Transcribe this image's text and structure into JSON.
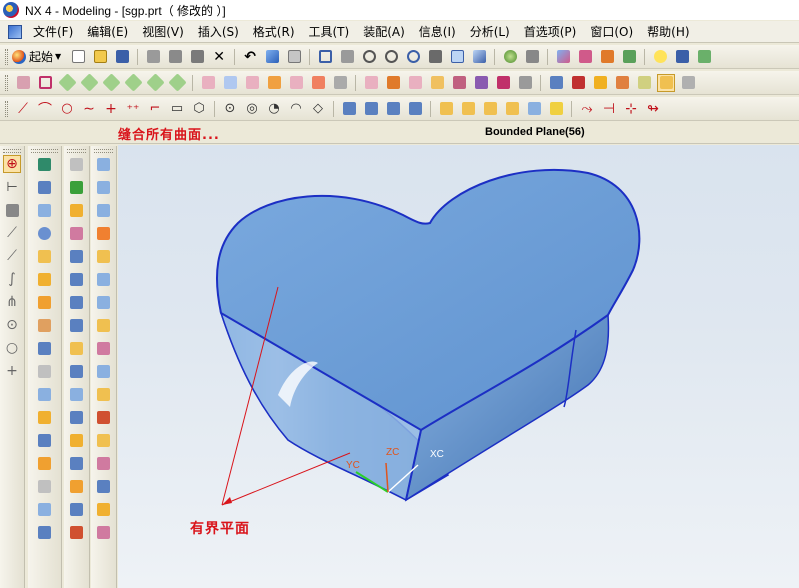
{
  "window": {
    "title": "NX 4 - Modeling - [sgp.prt（ 修改的 ）]"
  },
  "menu": {
    "items": [
      "文件(F)",
      "编辑(E)",
      "视图(V)",
      "插入(S)",
      "格式(R)",
      "工具(T)",
      "装配(A)",
      "信息(I)",
      "分析(L)",
      "首选项(P)",
      "窗口(O)",
      "帮助(H)"
    ]
  },
  "toolbar": {
    "start_label": "起始"
  },
  "cue": {
    "prompt": "缝合所有曲面..."
  },
  "status": {
    "selection": "Bounded Plane(56)"
  },
  "viewport": {
    "callout_label": "有界平面",
    "axes": {
      "xc": "XC",
      "yc": "YC",
      "zc": "ZC"
    }
  },
  "colors": {
    "annotation_red": "#d9141b",
    "model_face_blue": "#6fa0d8",
    "model_edge_blue": "#1c2fc4",
    "axis_xc": "#ffffff",
    "axis_yc": "#e0541c",
    "axis_zc": "#e0541c"
  },
  "icons": {
    "toolbar_row1": [
      "start-ball-icon",
      "new-file-icon",
      "open-folder-icon",
      "save-icon",
      "cut-icon",
      "copy-icon",
      "paste-icon",
      "delete-icon",
      "undo-icon",
      "repeat-icon",
      "select-icon",
      "fit-icon",
      "zoom-window-icon",
      "zoom-icon",
      "pan-icon",
      "rotate-icon",
      "view-icon",
      "shaded-icon",
      "wireframe-icon",
      "layer-icon",
      "measure-icon",
      "lightbulb-icon",
      "help-icon"
    ],
    "toolbar_row2": [
      "sketch-icon",
      "datum-plane-icon",
      "extrude-icon",
      "revolve-icon",
      "sweep-icon",
      "hole-icon",
      "boss-icon",
      "pad-icon",
      "blend-icon",
      "chamfer-icon",
      "shell-icon",
      "draft-icon",
      "mirror-icon",
      "pattern-icon",
      "unite-icon",
      "subtract-icon",
      "intersect-icon",
      "trim-icon",
      "split-icon",
      "offset-icon",
      "thicken-icon",
      "sew-icon",
      "bounded-plane-icon"
    ],
    "toolbar_row3": [
      "line-icon",
      "arc-icon",
      "circle-icon",
      "spline-icon",
      "point-icon",
      "point-set-icon",
      "fillet-curve-icon",
      "rectangle-icon",
      "polygon-icon",
      "ellipse-icon",
      "helix-icon",
      "text-icon",
      "offset-curve-icon",
      "project-curve-icon",
      "intersection-curve-icon",
      "section-curve-icon",
      "extract-curve-icon",
      "bridge-curve-icon",
      "join-curve-icon",
      "wrap-curve-icon",
      "trim-curve-icon",
      "divide-curve-icon"
    ]
  }
}
